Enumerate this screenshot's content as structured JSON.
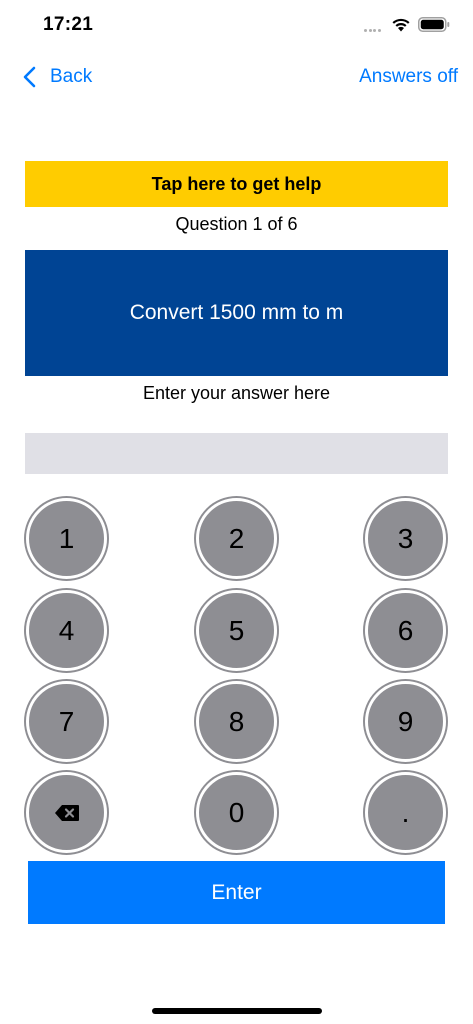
{
  "status_bar": {
    "time": "17:21",
    "icons": [
      "cellular-dots-icon",
      "wifi-icon",
      "battery-icon"
    ]
  },
  "nav": {
    "back_label": "Back",
    "back_icon": "chevron-left-icon",
    "answers_toggle_label": "Answers off"
  },
  "help": {
    "label": "Tap here to get help"
  },
  "question": {
    "counter": "Question 1 of 6",
    "text": "Convert 1500 mm to m"
  },
  "answer": {
    "prompt": "Enter your answer here",
    "value": "",
    "placeholder": ""
  },
  "keypad": {
    "keys": [
      "1",
      "2",
      "3",
      "4",
      "5",
      "6",
      "7",
      "8",
      "9",
      "",
      "0",
      "."
    ],
    "backspace_icon": "backspace-icon"
  },
  "enter_button": {
    "label": "Enter"
  },
  "colors": {
    "accent": "#007aff",
    "help_banner": "#ffcc00",
    "question_box": "#004494",
    "key_fill": "#8e8e93",
    "answer_field": "#e0e0e6"
  }
}
